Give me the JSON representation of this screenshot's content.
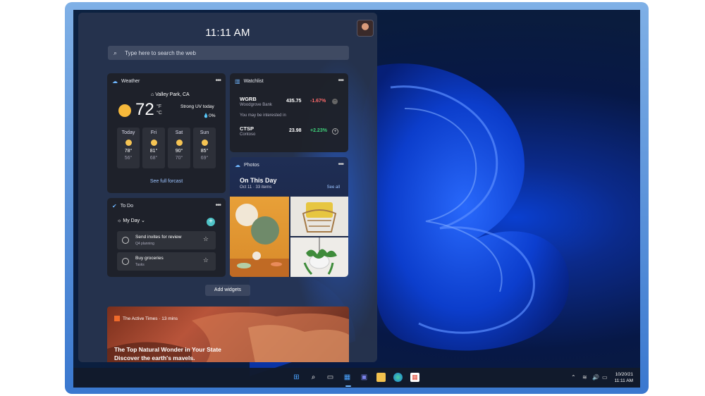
{
  "clock": "11:11 AM",
  "search": {
    "placeholder": "Type here to search the web"
  },
  "weather": {
    "title": "Weather",
    "location": "Valley Park, CA",
    "temp": "72",
    "unit_f": "°F",
    "unit_c": "°C",
    "condition": "Strong UV today",
    "precip": "0%",
    "days": [
      {
        "name": "Today",
        "high": "78°",
        "low": "56°"
      },
      {
        "name": "Fri",
        "high": "81°",
        "low": "68°"
      },
      {
        "name": "Sat",
        "high": "90°",
        "low": "70°"
      },
      {
        "name": "Sun",
        "high": "85°",
        "low": "69°"
      }
    ],
    "link": "See full forcast"
  },
  "watchlist": {
    "title": "Watchlist",
    "stocks": [
      {
        "symbol": "WGRB",
        "name": "Woodgrove Bank",
        "price": "435.75",
        "change": "-1.67%",
        "change_color": "#ff6b6b"
      },
      {
        "symbol": "CTSP",
        "name": "Contoso",
        "price": "23.98",
        "change": "+2.23%",
        "change_color": "#3fd17a"
      }
    ],
    "interested": "You may be interested in"
  },
  "photos": {
    "title": "Photos",
    "heading": "On This Day",
    "subheading": "Oct 11 · 33 items",
    "see_all": "See all"
  },
  "todo": {
    "title": "To Do",
    "list": "My Day",
    "tasks": [
      {
        "title": "Send invites for review",
        "subtitle": "Q4 planning"
      },
      {
        "title": "Buy groceries",
        "subtitle": "Tasks"
      }
    ]
  },
  "add_widgets": "Add widgets",
  "news": {
    "source": "The Active Times · 13 mins",
    "headline_1": "The Top Natural Wonder in Your State",
    "headline_2": "Discover the earth's mavels."
  },
  "taskbar": {
    "time": "11:11 AM",
    "date": "10/20/21"
  },
  "colors": {
    "accent": "#0a57d6",
    "link": "#9cc4ff"
  }
}
